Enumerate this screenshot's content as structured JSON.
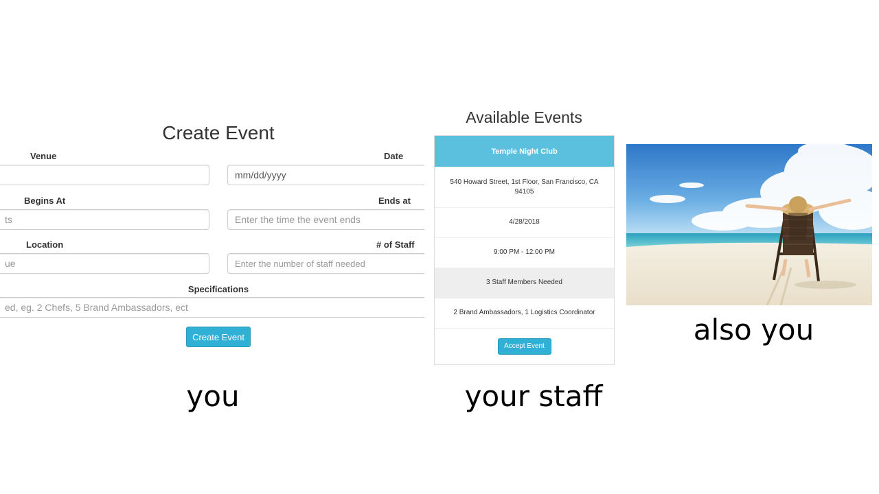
{
  "create_form": {
    "title": "Create Event",
    "venue_label": "Venue",
    "venue_value": "",
    "date_label": "Date",
    "date_placeholder": "mm/dd/yyyy",
    "begins_label": "Begins At",
    "begins_placeholder": "ts",
    "ends_label": "Ends at",
    "ends_placeholder": "Enter the time the event ends",
    "location_label": "Location",
    "location_placeholder": "ue",
    "staff_label": "# of Staff",
    "staff_placeholder": "Enter the number of staff needed",
    "spec_label": "Specifications",
    "spec_placeholder": "ed, eg. 2 Chefs, 5 Brand Ambassadors, ect",
    "submit_label": "Create Event"
  },
  "events": {
    "title": "Available Events",
    "venue": "Temple Night Club",
    "address": "540 Howard Street, 1st Floor, San Francisco, CA 94105",
    "date": "4/28/2018",
    "time": "9:00 PM - 12:00 PM",
    "staff_needed": "3 Staff Members Needed",
    "roles": "2 Brand Ambassadors, 1 Logistics Coordinator",
    "accept_label": "Accept Event"
  },
  "captions": {
    "you": "you",
    "staff": "your staff",
    "also_you": "also you"
  },
  "colors": {
    "accent": "#5bc0de",
    "button": "#31b0d5"
  }
}
